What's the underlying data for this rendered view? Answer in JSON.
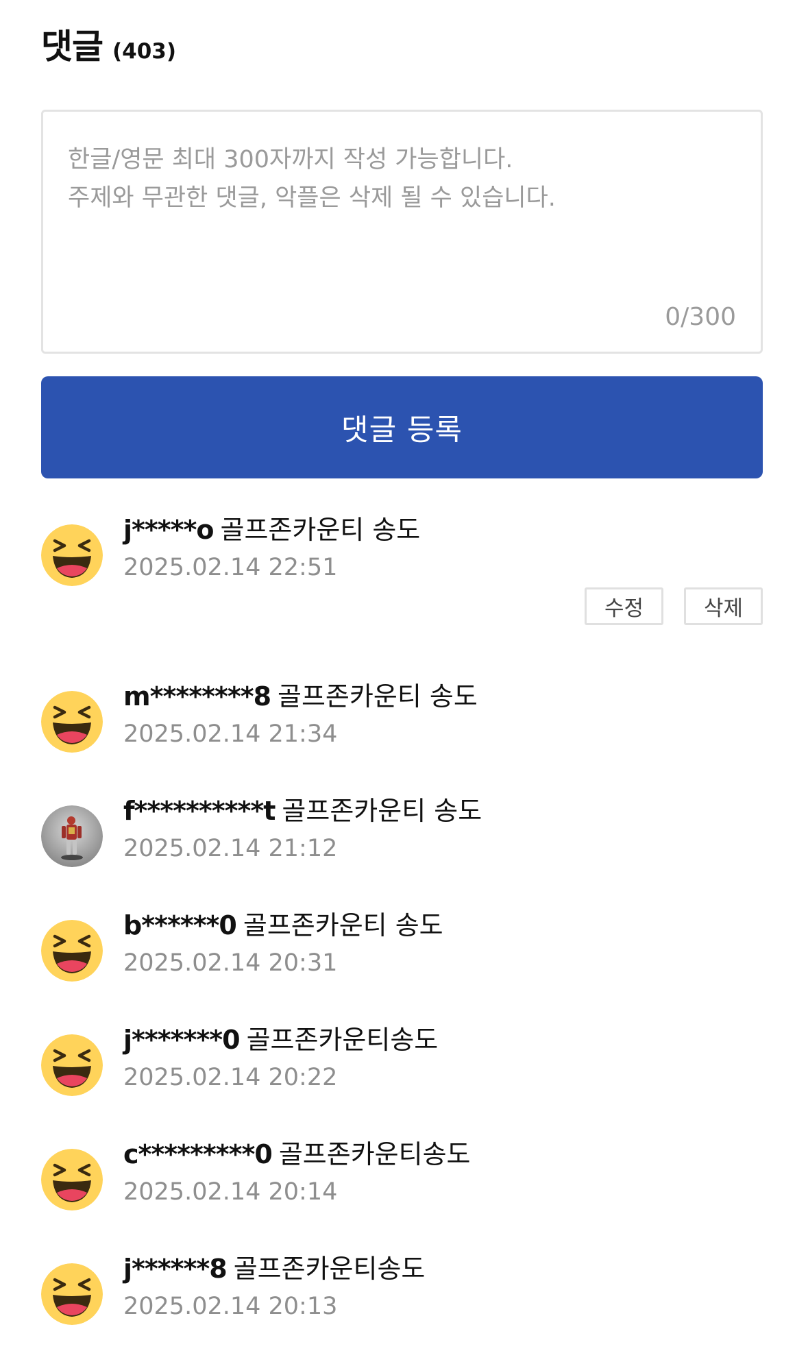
{
  "header": {
    "title": "댓글",
    "count": "(403)"
  },
  "comment_form": {
    "placeholder": "한글/영문 최대 300자까지 작성 가능합니다.\n주제와 무관한 댓글, 악플은 삭제 될 수 있습니다.",
    "counter": "0/300",
    "submit_label": "댓글 등록"
  },
  "comments": [
    {
      "author": "j*****o",
      "text": "골프존카운티 송도",
      "date": "2025.02.14 22:51",
      "avatar": "laughing-emoji",
      "own": true
    },
    {
      "author": "m********8",
      "text": "골프존카운티 송도",
      "date": "2025.02.14 21:34",
      "avatar": "laughing-emoji"
    },
    {
      "author": "f**********t",
      "text": "골프존카운티 송도",
      "date": "2025.02.14 21:12",
      "avatar": "armored-figure-photo"
    },
    {
      "author": "b******0",
      "text": "골프존카운티 송도",
      "date": "2025.02.14 20:31",
      "avatar": "laughing-emoji"
    },
    {
      "author": "j*******0",
      "text": "골프존카운티송도",
      "date": "2025.02.14 20:22",
      "avatar": "laughing-emoji"
    },
    {
      "author": "c*********0",
      "text": "골프존카운티송도",
      "date": "2025.02.14 20:14",
      "avatar": "laughing-emoji"
    },
    {
      "author": "j******8",
      "text": "골프존카운티송도",
      "date": "2025.02.14 20:13",
      "avatar": "laughing-emoji"
    }
  ],
  "actions": {
    "edit_label": "수정",
    "delete_label": "삭제"
  },
  "colors": {
    "primary": "#2c53b0",
    "emoji_yellow": "#ffd35a",
    "emoji_mouth": "#e9455f"
  }
}
